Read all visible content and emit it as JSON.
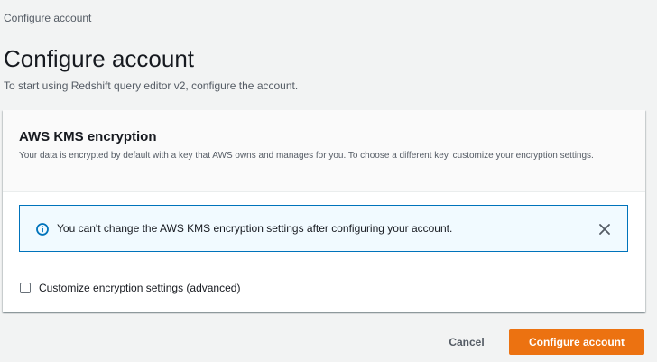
{
  "breadcrumb": {
    "current": "Configure account"
  },
  "page": {
    "title": "Configure account",
    "subtitle": "To start using Redshift query editor v2, configure the account."
  },
  "kms_panel": {
    "title": "AWS KMS encryption",
    "description": "Your data is encrypted by default with a key that AWS owns and manages for you. To choose a different key, customize your encryption settings.",
    "alert": {
      "icon": "info-icon",
      "text": "You can't change the AWS KMS encryption settings after configuring your account.",
      "close_icon": "close-icon"
    },
    "customize_checkbox": {
      "label": "Customize encryption settings (advanced)",
      "checked": false
    }
  },
  "actions": {
    "cancel_label": "Cancel",
    "configure_label": "Configure account"
  },
  "colors": {
    "page_background": "#f2f3f3",
    "primary": "#ec7211",
    "info_border": "#0073bb",
    "info_background": "#f1faff",
    "text_primary": "#16191f",
    "text_secondary": "#545b64"
  }
}
